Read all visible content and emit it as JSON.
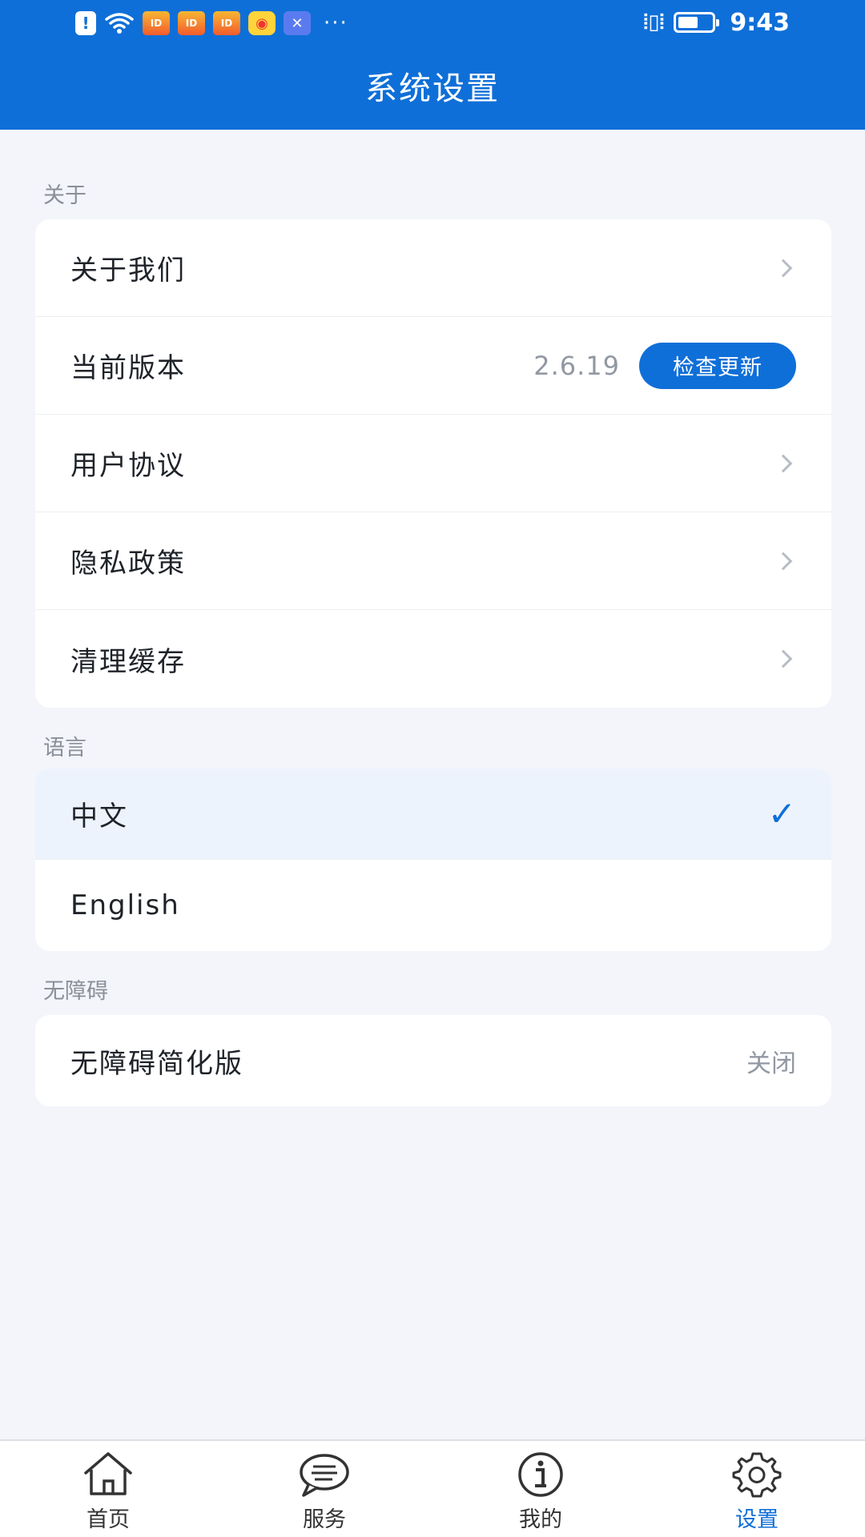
{
  "status_bar": {
    "time": "9:43",
    "battery_level": 0.6,
    "notification_icons": [
      "alert-icon",
      "wifi-icon",
      "app-icon",
      "app-icon",
      "app-icon",
      "weibo-icon",
      "x-app-icon",
      "more-dots-icon"
    ]
  },
  "header": {
    "title": "系统设置"
  },
  "sections": {
    "about": {
      "label": "关于",
      "items": [
        {
          "label": "关于我们"
        },
        {
          "label": "当前版本",
          "value": "2.6.19",
          "button": "检查更新"
        },
        {
          "label": "用户协议"
        },
        {
          "label": "隐私政策"
        },
        {
          "label": "清理缓存"
        }
      ]
    },
    "language": {
      "label": "语言",
      "items": [
        {
          "label": "中文",
          "selected": true
        },
        {
          "label": "English",
          "selected": false
        }
      ]
    },
    "accessibility": {
      "label": "无障碍",
      "items": [
        {
          "label": "无障碍简化版",
          "value": "关闭"
        }
      ]
    }
  },
  "bottom_nav": {
    "items": [
      {
        "label": "首页",
        "icon": "home-icon"
      },
      {
        "label": "服务",
        "icon": "chat-icon"
      },
      {
        "label": "我的",
        "icon": "info-icon"
      },
      {
        "label": "设置",
        "icon": "gear-icon",
        "active": true
      }
    ]
  },
  "colors": {
    "primary": "#0f6fd8",
    "background": "#f3f5fa",
    "selected_row": "#edf3fc"
  }
}
